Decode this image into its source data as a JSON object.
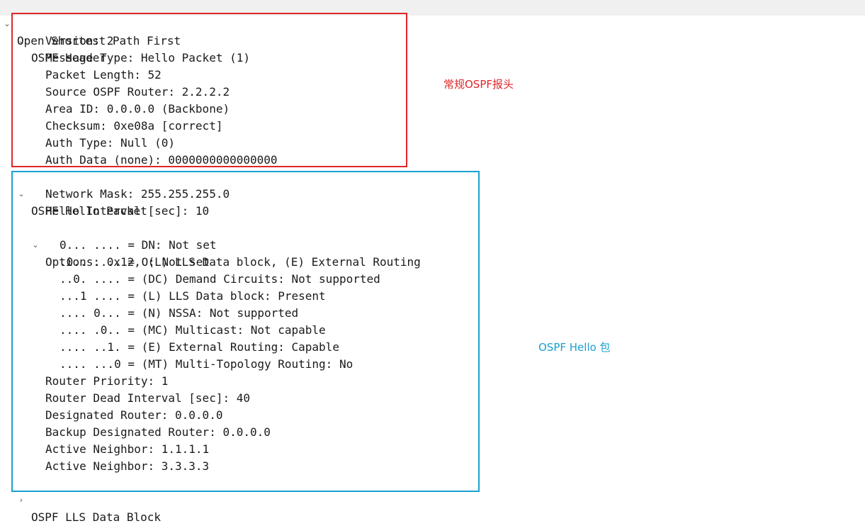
{
  "tree": {
    "root": "Open Shortest Path First",
    "header": {
      "label": "OSPF Header",
      "fields": [
        "Version: 2",
        "Message Type: Hello Packet (1)",
        "Packet Length: 52",
        "Source OSPF Router: 2.2.2.2",
        "Area ID: 0.0.0.0 (Backbone)",
        "Checksum: 0xe08a [correct]",
        "Auth Type: Null (0)",
        "Auth Data (none): 0000000000000000"
      ]
    },
    "hello": {
      "label": "OSPF Hello Packet",
      "network_mask": "Network Mask: 255.255.255.0",
      "hello_interval": "Hello Interval [sec]: 10",
      "options_label": "Options: 0x12, (L) LLS Data block, (E) External Routing",
      "option_bits": [
        "0... .... = DN: Not set",
        ".0.. .... = O: Not set",
        "..0. .... = (DC) Demand Circuits: Not supported",
        "...1 .... = (L) LLS Data block: Present",
        ".... 0... = (N) NSSA: Not supported",
        ".... .0.. = (MC) Multicast: Not capable",
        ".... ..1. = (E) External Routing: Capable",
        ".... ...0 = (MT) Multi-Topology Routing: No"
      ],
      "fields_after": [
        "Router Priority: 1",
        "Router Dead Interval [sec]: 40",
        "Designated Router: 0.0.0.0",
        "Backup Designated Router: 0.0.0.0",
        "Active Neighbor: 1.1.1.1",
        "Active Neighbor: 3.3.3.3"
      ]
    },
    "lls": {
      "label": "OSPF LLS Data Block"
    }
  },
  "annotations": {
    "header_note": "常规OSPF报头",
    "hello_note": "OSPF Hello 包"
  },
  "colors": {
    "header_frame": "#e0262a",
    "hello_frame": "#1aa0cf"
  },
  "icons": {
    "expanded": "chevron-down-icon",
    "collapsed": "chevron-right-icon"
  }
}
